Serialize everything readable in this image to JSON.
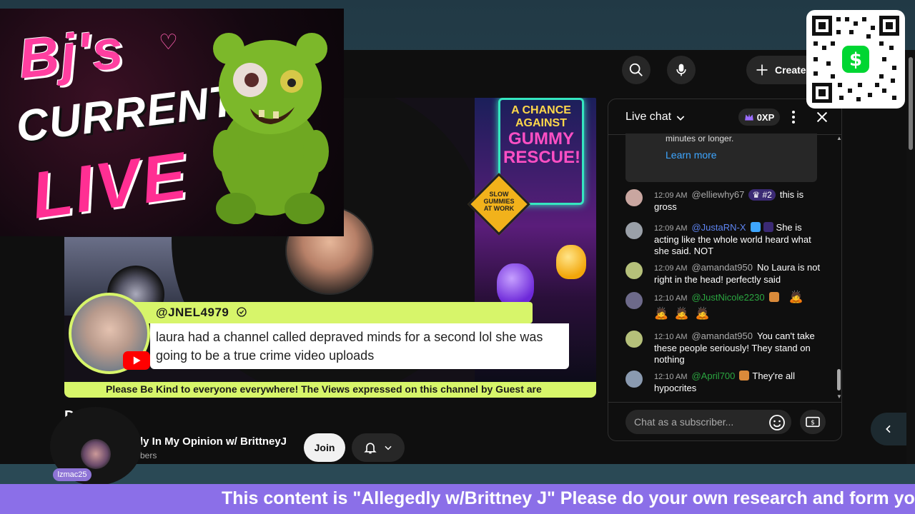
{
  "overlay_logo": {
    "line1": "Bj's",
    "line2": "CURRENT",
    "line3": "LIVE"
  },
  "header": {
    "create_label": "Create",
    "search_icon": "search-icon",
    "mic_icon": "microphone-icon"
  },
  "video": {
    "sign_line1": "A CHANCE AGAINST",
    "sign_line2": "GUMMY RESCUE!",
    "warning_sign_line1": "SLOW",
    "warning_sign_line2": "GUMMIES",
    "warning_sign_line3": "AT WORK",
    "comment": {
      "author": "@JNEL4979",
      "text": "laura had a channel called depraved minds for a second lol she was going to be a true crime video uploads"
    },
    "ticker": "Please Be Kind to everyone everywhere! The Views expressed on this channel by Guest are"
  },
  "channel": {
    "title_partial": "D       l",
    "name": "ly In My Opinion w/ BrittneyJ",
    "subs": "bers",
    "join_label": "Join"
  },
  "webcam": {
    "badge": "lzmac25"
  },
  "chat": {
    "title": "Live chat",
    "xp": "0XP",
    "notice_text": "minutes or longer.",
    "notice_link": "Learn more",
    "input_placeholder": "Chat as a subscriber...",
    "messages": [
      {
        "time": "12:09 AM",
        "author": "@elliewhy67",
        "badge": "#2",
        "text": "this is gross"
      },
      {
        "time": "12:09 AM",
        "author": "@JustaRN-X",
        "text": "She is acting like the whole world heard what she said. NOT"
      },
      {
        "time": "12:09 AM",
        "author": "@amandat950",
        "text": "No Laura is not right in the head! perfectly said"
      },
      {
        "time": "12:10 AM",
        "author": "@JustNicole2230",
        "text": ""
      },
      {
        "time": "12:10 AM",
        "author": "@amandat950",
        "text": "You can't take these people seriously! They stand on nothing"
      },
      {
        "time": "12:10 AM",
        "author": "@April700",
        "text": "They're all hypocrites"
      }
    ]
  },
  "marquee": {
    "text": "This content is \"Allegedly w/Brittney J\" Please do your own research and form yo"
  },
  "colors": {
    "accent_green": "#d7f56a",
    "marquee_purple": "#8b6fe8",
    "link_blue": "#3ea6ff",
    "member_green": "#2ba640"
  }
}
